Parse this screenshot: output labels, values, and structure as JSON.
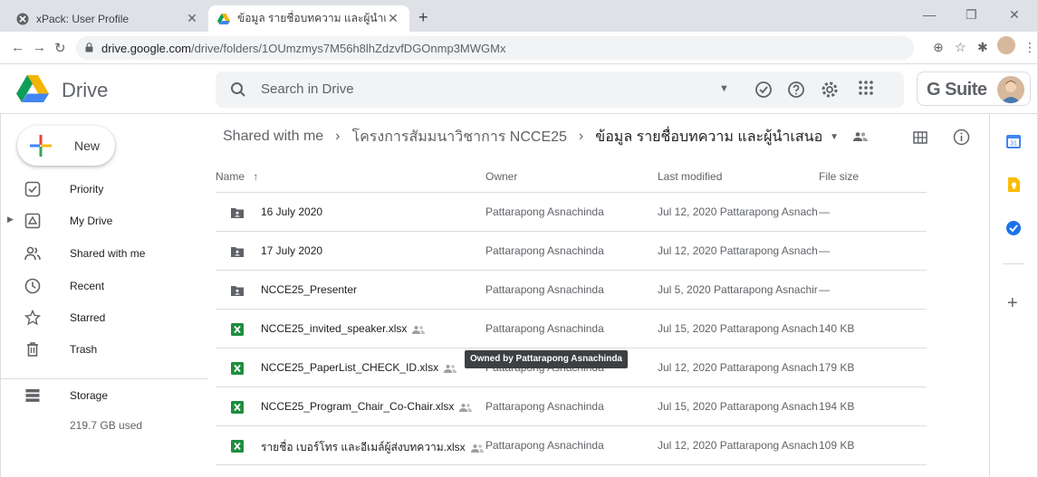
{
  "browser": {
    "tabs": [
      {
        "title": "xPack: User Profile",
        "close": "✕"
      },
      {
        "title": "ข้อมูล รายชื่อบทความ และผู้นำเสนอ -",
        "close": "✕"
      }
    ],
    "new_tab": "+",
    "url_host": "drive.google.com",
    "url_path": "/drive/folders/1OUmzmys7M56h8lhZdzvfDGOnmp3MWGMx"
  },
  "header": {
    "app_name": "Drive",
    "search_placeholder": "Search in Drive",
    "gsuite_label": "G Suite"
  },
  "sidebar": {
    "new_label": "New",
    "items": [
      {
        "label": "Priority",
        "icon": "priority-icon"
      },
      {
        "label": "My Drive",
        "icon": "my-drive-icon"
      },
      {
        "label": "Shared with me",
        "icon": "shared-icon"
      },
      {
        "label": "Recent",
        "icon": "recent-icon"
      },
      {
        "label": "Starred",
        "icon": "star-icon"
      },
      {
        "label": "Trash",
        "icon": "trash-icon"
      },
      {
        "label": "Storage",
        "icon": "storage-icon"
      }
    ],
    "storage_used": "219.7 GB used"
  },
  "breadcrumb": {
    "root": "Shared with me",
    "parent": "โครงการสัมมนาวิชาการ NCCE25",
    "current": "ข้อมูล รายชื่อบทความ และผู้นำเสนอ"
  },
  "columns": {
    "name": "Name",
    "owner": "Owner",
    "modified": "Last modified",
    "size": "File size"
  },
  "files": [
    {
      "name": "16 July 2020",
      "type": "shared-folder",
      "shared": false,
      "owner": "Pattarapong Asnachinda",
      "modified": "Jul 12, 2020 Pattarapong Asnach",
      "size": "—"
    },
    {
      "name": "17 July 2020",
      "type": "shared-folder",
      "shared": false,
      "owner": "Pattarapong Asnachinda",
      "modified": "Jul 12, 2020 Pattarapong Asnach",
      "size": "—"
    },
    {
      "name": "NCCE25_Presenter",
      "type": "shared-folder",
      "shared": false,
      "owner": "Pattarapong Asnachinda",
      "modified": "Jul 5, 2020 Pattarapong Asnachir",
      "size": "—"
    },
    {
      "name": "NCCE25_invited_speaker.xlsx",
      "type": "excel",
      "shared": true,
      "owner": "Pattarapong Asnachinda",
      "modified": "Jul 15, 2020 Pattarapong Asnach",
      "size": "140 KB"
    },
    {
      "name": "NCCE25_PaperList_CHECK_ID.xlsx",
      "type": "excel",
      "shared": true,
      "owner": "Pattarapong Asnachinda",
      "modified": "Jul 12, 2020 Pattarapong Asnach",
      "size": "179 KB"
    },
    {
      "name": "NCCE25_Program_Chair_Co-Chair.xlsx",
      "type": "excel",
      "shared": true,
      "owner": "Pattarapong Asnachinda",
      "modified": "Jul 15, 2020 Pattarapong Asnach",
      "size": "194 KB"
    },
    {
      "name": "รายชื่อ เบอร์โทร และอีเมล์ผู้ส่งบทความ.xlsx",
      "type": "excel",
      "shared": true,
      "owner": "Pattarapong Asnachinda",
      "modified": "Jul 12, 2020 Pattarapong Asnach",
      "size": "109 KB"
    }
  ],
  "tooltip": "Owned by Pattarapong Asnachinda",
  "colors": {
    "drive_green": "#0f9d58",
    "drive_yellow": "#f4b400",
    "drive_blue": "#4285f4",
    "excel_green": "#1e8e3e"
  }
}
